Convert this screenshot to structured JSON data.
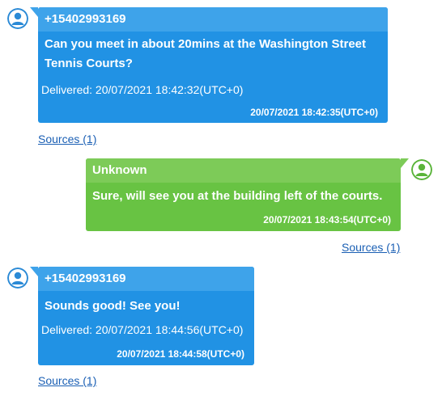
{
  "messages": [
    {
      "sender": "+15402993169",
      "text": "Can you meet in about 20mins at the Washington Street Tennis Courts?",
      "delivered": "Delivered: 20/07/2021 18:42:32(UTC+0)",
      "timestamp": "20/07/2021 18:42:35(UTC+0)",
      "sources": "Sources (1)",
      "direction": "incoming"
    },
    {
      "sender": "Unknown",
      "text": "Sure, will see you at the building left of the courts.",
      "timestamp": "20/07/2021 18:43:54(UTC+0)",
      "sources": "Sources (1)",
      "direction": "outgoing"
    },
    {
      "sender": "+15402993169",
      "text": "Sounds good! See you!",
      "delivered": "Delivered: 20/07/2021 18:44:56(UTC+0)",
      "timestamp": "20/07/2021 18:44:58(UTC+0)",
      "sources": "Sources (1)",
      "direction": "incoming"
    }
  ],
  "colors": {
    "incoming_bubble": "#2192e4",
    "incoming_header": "#3ea3ea",
    "outgoing_bubble": "#68c343",
    "outgoing_header": "#7dcb58",
    "avatar_blue": "#2b8ad6",
    "avatar_green": "#5ab43a",
    "link": "#1a5fb4"
  },
  "icons": {
    "avatar": "user-avatar-icon"
  }
}
